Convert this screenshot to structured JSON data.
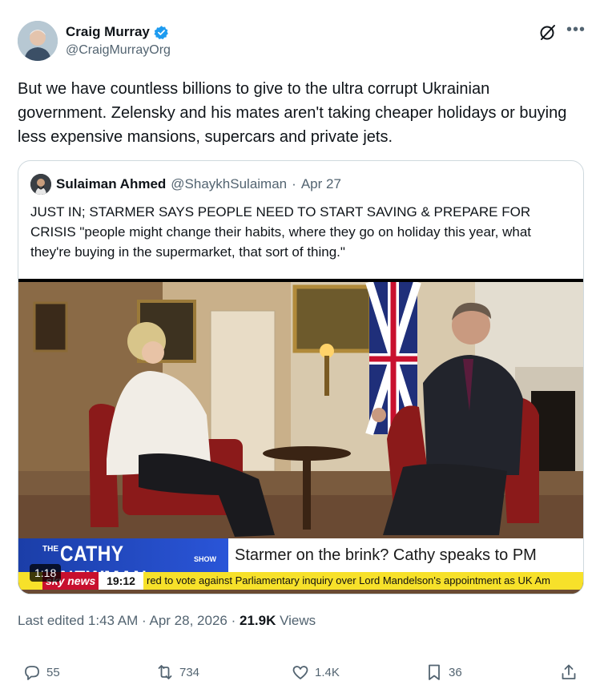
{
  "author": {
    "name": "Craig Murray",
    "handle": "@CraigMurrayOrg",
    "verified": true
  },
  "tweet": {
    "text": "But we have countless billions to give to the ultra corrupt Ukrainian government. Zelensky and his mates aren't taking cheaper holidays or buying less expensive mansions, supercars and private jets."
  },
  "quote": {
    "name": "Sulaiman Ahmed",
    "handle": "@ShaykhSulaiman",
    "separator": "·",
    "date": "Apr 27",
    "text": "JUST IN; STARMER SAYS PEOPLE NEED TO START SAVING & PREPARE FOR CRISIS \"people might change their habits, where they go on holiday this year, what they're buying in the supermarket, that sort of thing.\"",
    "video": {
      "duration": "1:18",
      "banner_the": "THE",
      "banner_show_name": "CATHY NEWMAN",
      "banner_show": "SHOW",
      "headline": "Starmer on the brink? Cathy speaks to PM",
      "ticker_brand": "sky news",
      "ticker_time": "19:12",
      "ticker_text": "red to vote against Parliamentary inquiry over Lord Mandelson's appointment as UK Am"
    }
  },
  "meta": {
    "edited_label": "Last edited",
    "time": "1:43 AM",
    "dot": "·",
    "date": "Apr 28, 2026",
    "views_count": "21.9K",
    "views_label": "Views"
  },
  "actions": {
    "replies": "55",
    "reposts": "734",
    "likes": "1.4K",
    "bookmarks": "36"
  },
  "colors": {
    "text": "#0f1419",
    "secondary": "#536471",
    "verified": "#1d9bf0",
    "border": "#cfd9de"
  }
}
